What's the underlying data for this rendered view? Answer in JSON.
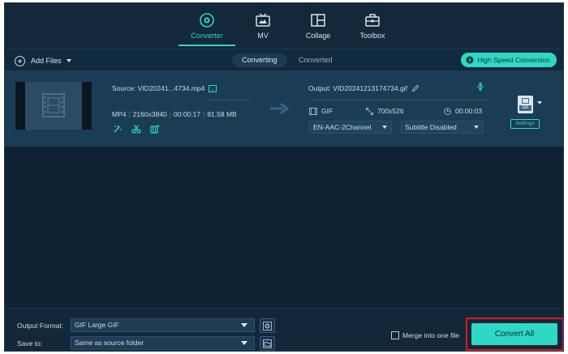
{
  "nav": {
    "items": [
      {
        "label": "Converter",
        "icon": "converter-icon",
        "active": true
      },
      {
        "label": "MV",
        "icon": "mv-icon"
      },
      {
        "label": "Collage",
        "icon": "collage-icon"
      },
      {
        "label": "Toolbox",
        "icon": "toolbox-icon"
      }
    ]
  },
  "toolbar": {
    "add_files": "Add Files",
    "tabs": {
      "converting": "Converting",
      "converted": "Converted"
    },
    "high_speed": "High Speed Conversion"
  },
  "file": {
    "source": "Source: VID20241...4734.mp4",
    "format": "MP4",
    "resolution": "2160x3840",
    "duration": "00:00:17",
    "size": "81.58 MB",
    "output": "Output: VID20241213174734.gif",
    "out_format": "GIF",
    "out_resolution": "700x526",
    "out_duration": "00:00:03",
    "audio_track": "EN-AAC-2Channel",
    "subtitle": "Subtitle Disabled",
    "format_badge": "GIF",
    "settings_label": "Settings"
  },
  "bottom": {
    "output_format_label": "Output Format:",
    "output_format_value": "GIF Large GIF",
    "save_to_label": "Save to:",
    "save_to_value": "Same as source folder",
    "merge_label": "Merge into one file",
    "convert_label": "Convert All"
  },
  "colors": {
    "accent": "#2fd8c5",
    "background": "#0e2233",
    "file_row": "#1b3c55",
    "highlight": "#e01520"
  }
}
